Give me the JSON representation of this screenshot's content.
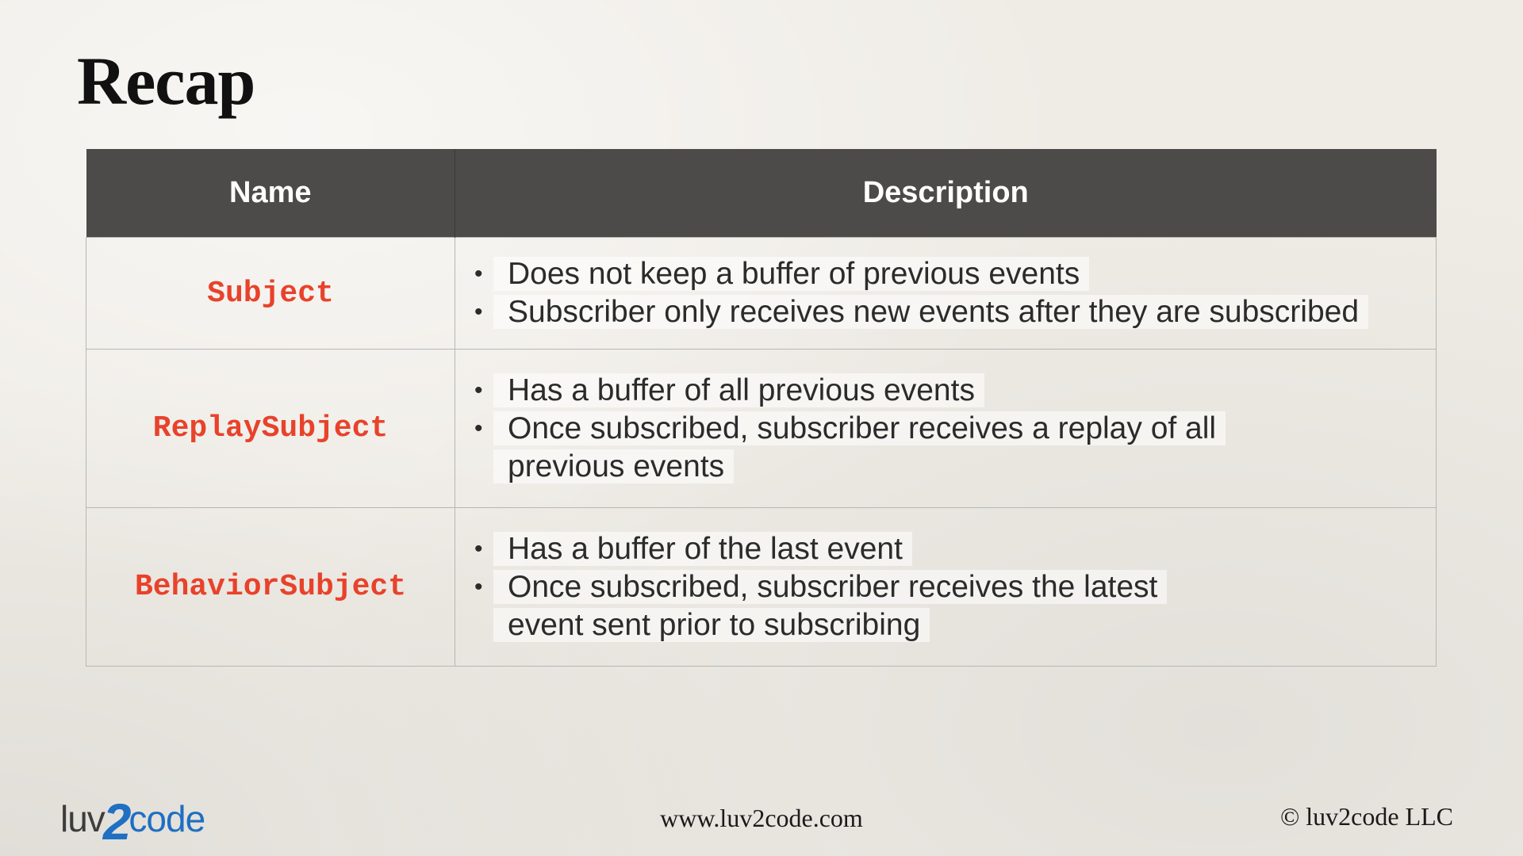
{
  "title": "Recap",
  "table": {
    "headers": {
      "name": "Name",
      "description": "Description"
    },
    "rows": [
      {
        "name": "Subject",
        "items": [
          "Does not keep a buffer of previous events",
          "Subscriber only receives new events after they are subscribed"
        ]
      },
      {
        "name": "ReplaySubject",
        "items": [
          "Has a buffer of all previous events",
          "Once subscribed, subscriber receives a replay of all previous events"
        ]
      },
      {
        "name": "BehaviorSubject",
        "items": [
          "Has a buffer of the last event",
          "Once subscribed, subscriber receives the latest event sent prior to subscribing"
        ]
      }
    ]
  },
  "bullet_char": "•",
  "footer": {
    "logo": {
      "part1": "luv",
      "part2": "2",
      "part3": "code"
    },
    "url": "www.luv2code.com",
    "copyright": "© luv2code LLC"
  },
  "colors": {
    "name_accent": "#e8422b",
    "header_bg": "#4d4b4a",
    "logo_blue": "#1f6fc2"
  }
}
